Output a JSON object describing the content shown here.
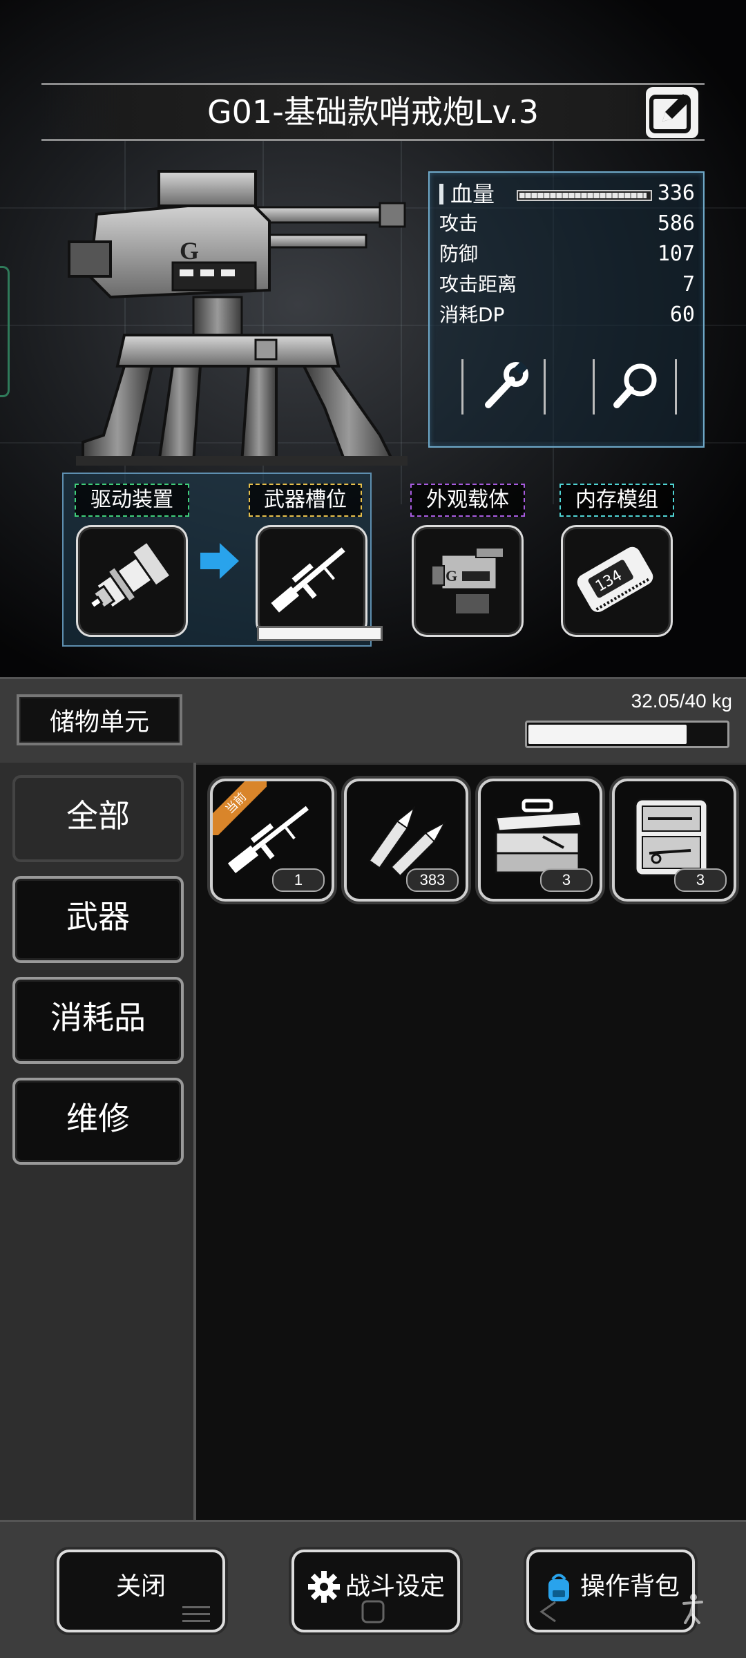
{
  "header": {
    "title": "G01-基础款哨戒炮Lv.3",
    "edit_icon": "edit-icon"
  },
  "stats": {
    "hp": {
      "label": "血量",
      "value": "336",
      "fill_fraction": 0.98
    },
    "rows": [
      {
        "label": "攻击",
        "value": "586"
      },
      {
        "label": "防御",
        "value": "107"
      },
      {
        "label": "攻击距离",
        "value": "7"
      },
      {
        "label": "消耗DP",
        "value": "60"
      }
    ],
    "tools": [
      "wrench-icon",
      "magnifier-icon"
    ]
  },
  "slots": [
    {
      "label": "驱动装置",
      "color": "#3fcf7a",
      "icon": "vise-icon"
    },
    {
      "label": "武器槽位",
      "color": "#e8c04a",
      "icon": "sniper-rifle-icon",
      "bar_fill": 1.0
    },
    {
      "label": "外观载体",
      "color": "#a85be0",
      "icon": "turret-shell-icon"
    },
    {
      "label": "内存模组",
      "color": "#4fd4d4",
      "icon": "memory-chip-icon",
      "chip_text": "134"
    }
  ],
  "storage": {
    "label": "储物单元",
    "capacity_text": "32.05/40 kg",
    "capacity_fraction": 0.8
  },
  "categories": [
    {
      "label": "全部",
      "active": true
    },
    {
      "label": "武器",
      "active": false
    },
    {
      "label": "消耗品",
      "active": false
    },
    {
      "label": "维修",
      "active": false
    }
  ],
  "items": [
    {
      "icon": "sniper-rifle-icon",
      "count": "1",
      "ribbon": "当前"
    },
    {
      "icon": "bullets-icon",
      "count": "383"
    },
    {
      "icon": "toolbox-icon",
      "count": "3"
    },
    {
      "icon": "repair-kit-icon",
      "count": "3"
    }
  ],
  "footer": {
    "close_label": "关闭",
    "battle_label": "战斗设定",
    "backpack_label": "操作背包"
  },
  "colors": {
    "accent_blue": "#29a3ec",
    "ribbon_orange": "#d9852a"
  }
}
